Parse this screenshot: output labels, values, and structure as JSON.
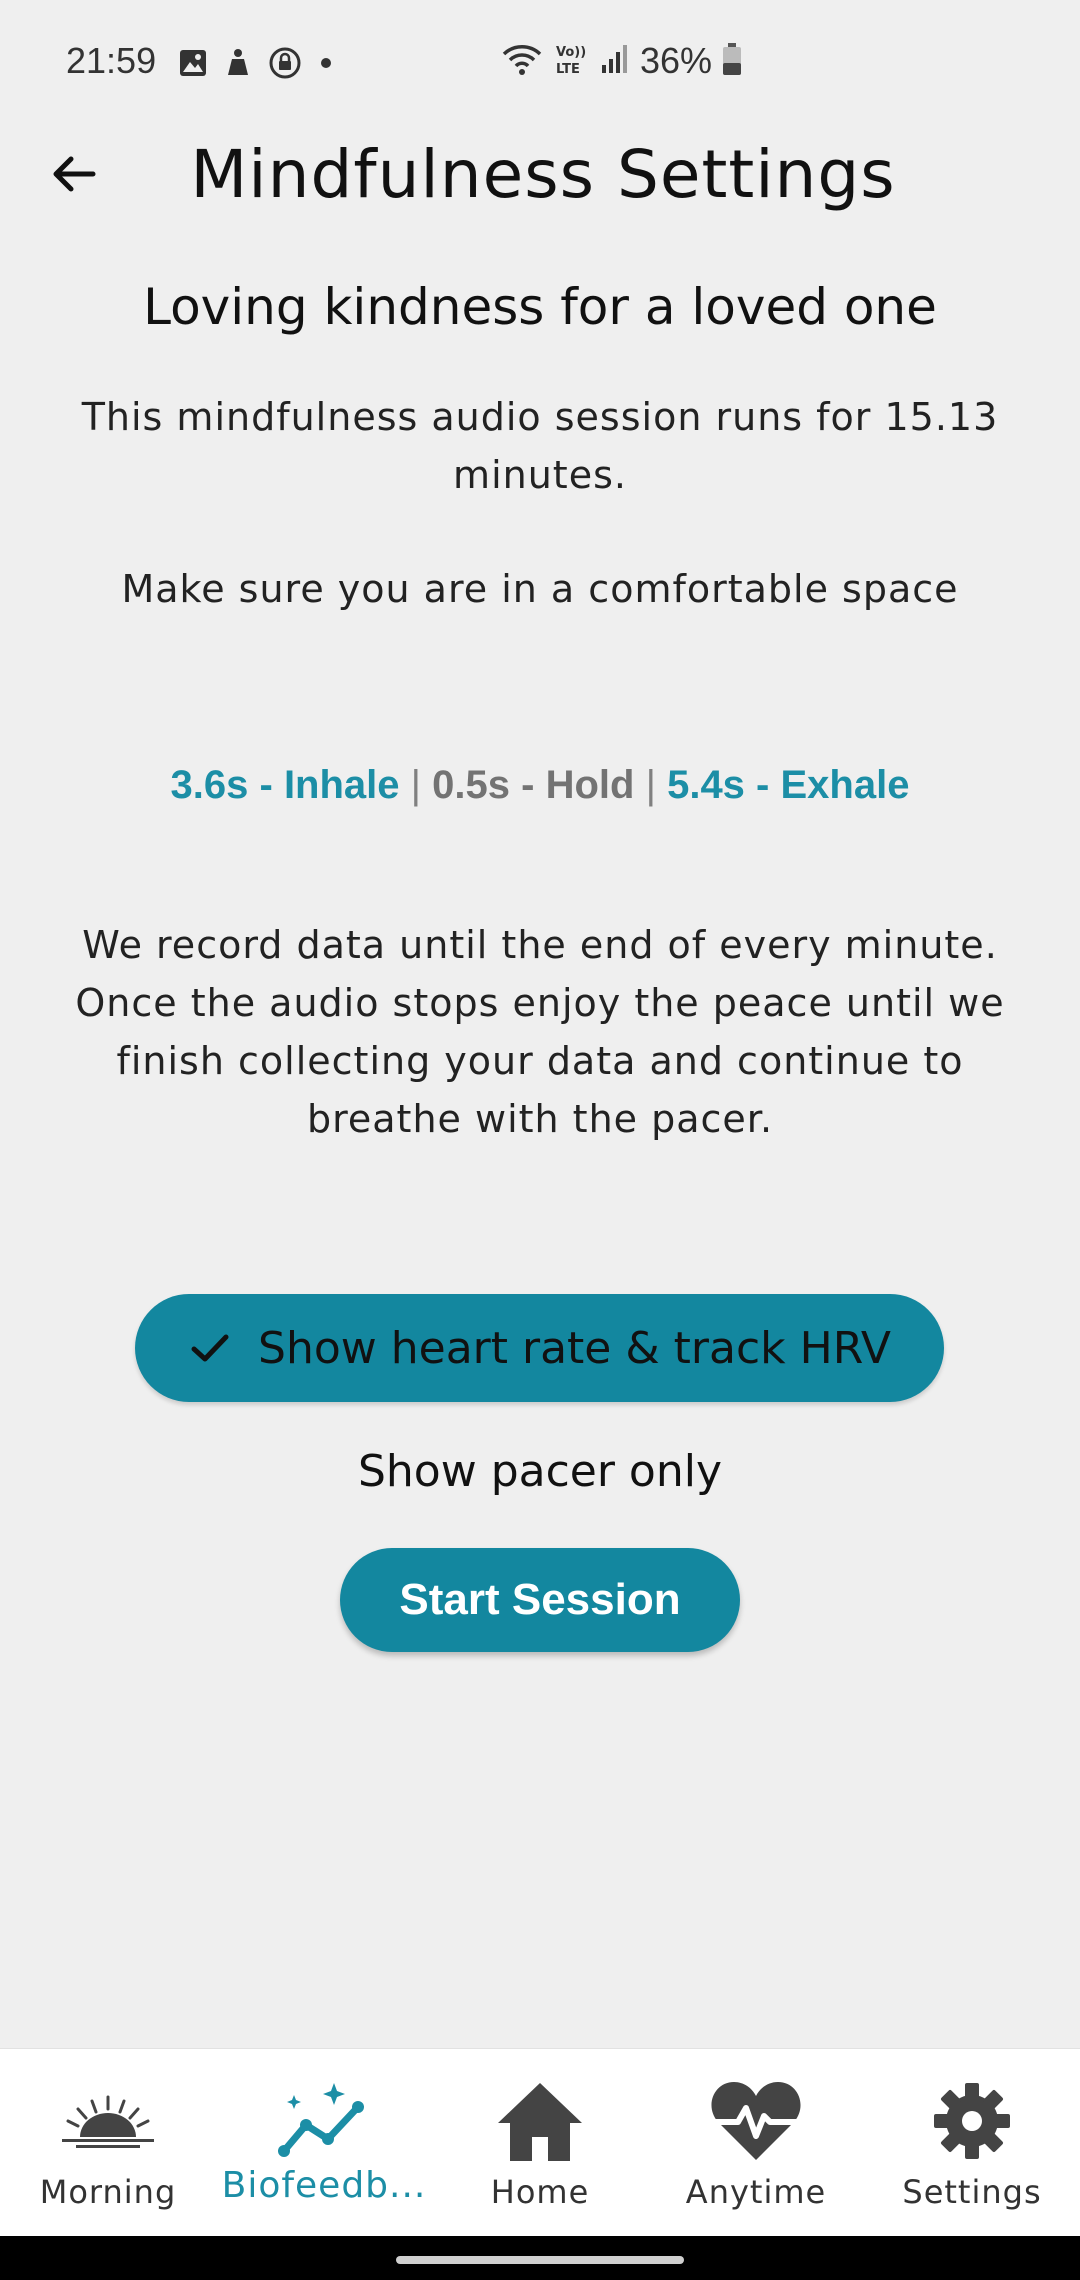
{
  "status_bar": {
    "time": "21:59",
    "battery": "36%",
    "icons_left": [
      "image-icon",
      "notification-icon",
      "vpn-lock-icon",
      "dot-icon"
    ],
    "icons_right": [
      "wifi-icon",
      "volte-icon",
      "signal-icon",
      "battery-icon"
    ]
  },
  "header": {
    "title": "Mindfulness Settings",
    "back_icon": "arrow-left-icon"
  },
  "session": {
    "title": "Loving kindness for a loved one",
    "duration_text": "This mindfulness audio session runs for 15.13 minutes.",
    "comfort_text": "Make sure you are in a comfortable space",
    "breathing": {
      "inhale": "3.6s - Inhale",
      "hold": "0.5s - Hold",
      "exhale": "5.4s - Exhale",
      "separator": "|"
    },
    "recording_text": "We record data until the end of every minute. Once the audio stops enjoy the peace until we finish collecting your data and continue to breathe with the pacer."
  },
  "options": {
    "hr_toggle_label": "Show heart rate & track HRV",
    "hr_toggle_selected": true,
    "pacer_only_label": "Show pacer only",
    "start_button": "Start Session"
  },
  "bottom_nav": {
    "active": "biofeedback",
    "items": [
      {
        "label": "Morning",
        "icon": "sunrise-icon"
      },
      {
        "label": "Biofeedb...",
        "icon": "sparkle-graph-icon"
      },
      {
        "label": "Home",
        "icon": "home-icon"
      },
      {
        "label": "Anytime",
        "icon": "heart-pulse-icon"
      },
      {
        "label": "Settings",
        "icon": "gear-icon"
      }
    ]
  },
  "colors": {
    "accent": "#13879f",
    "accent_text": "#1c8ea6",
    "background": "#efefef"
  }
}
